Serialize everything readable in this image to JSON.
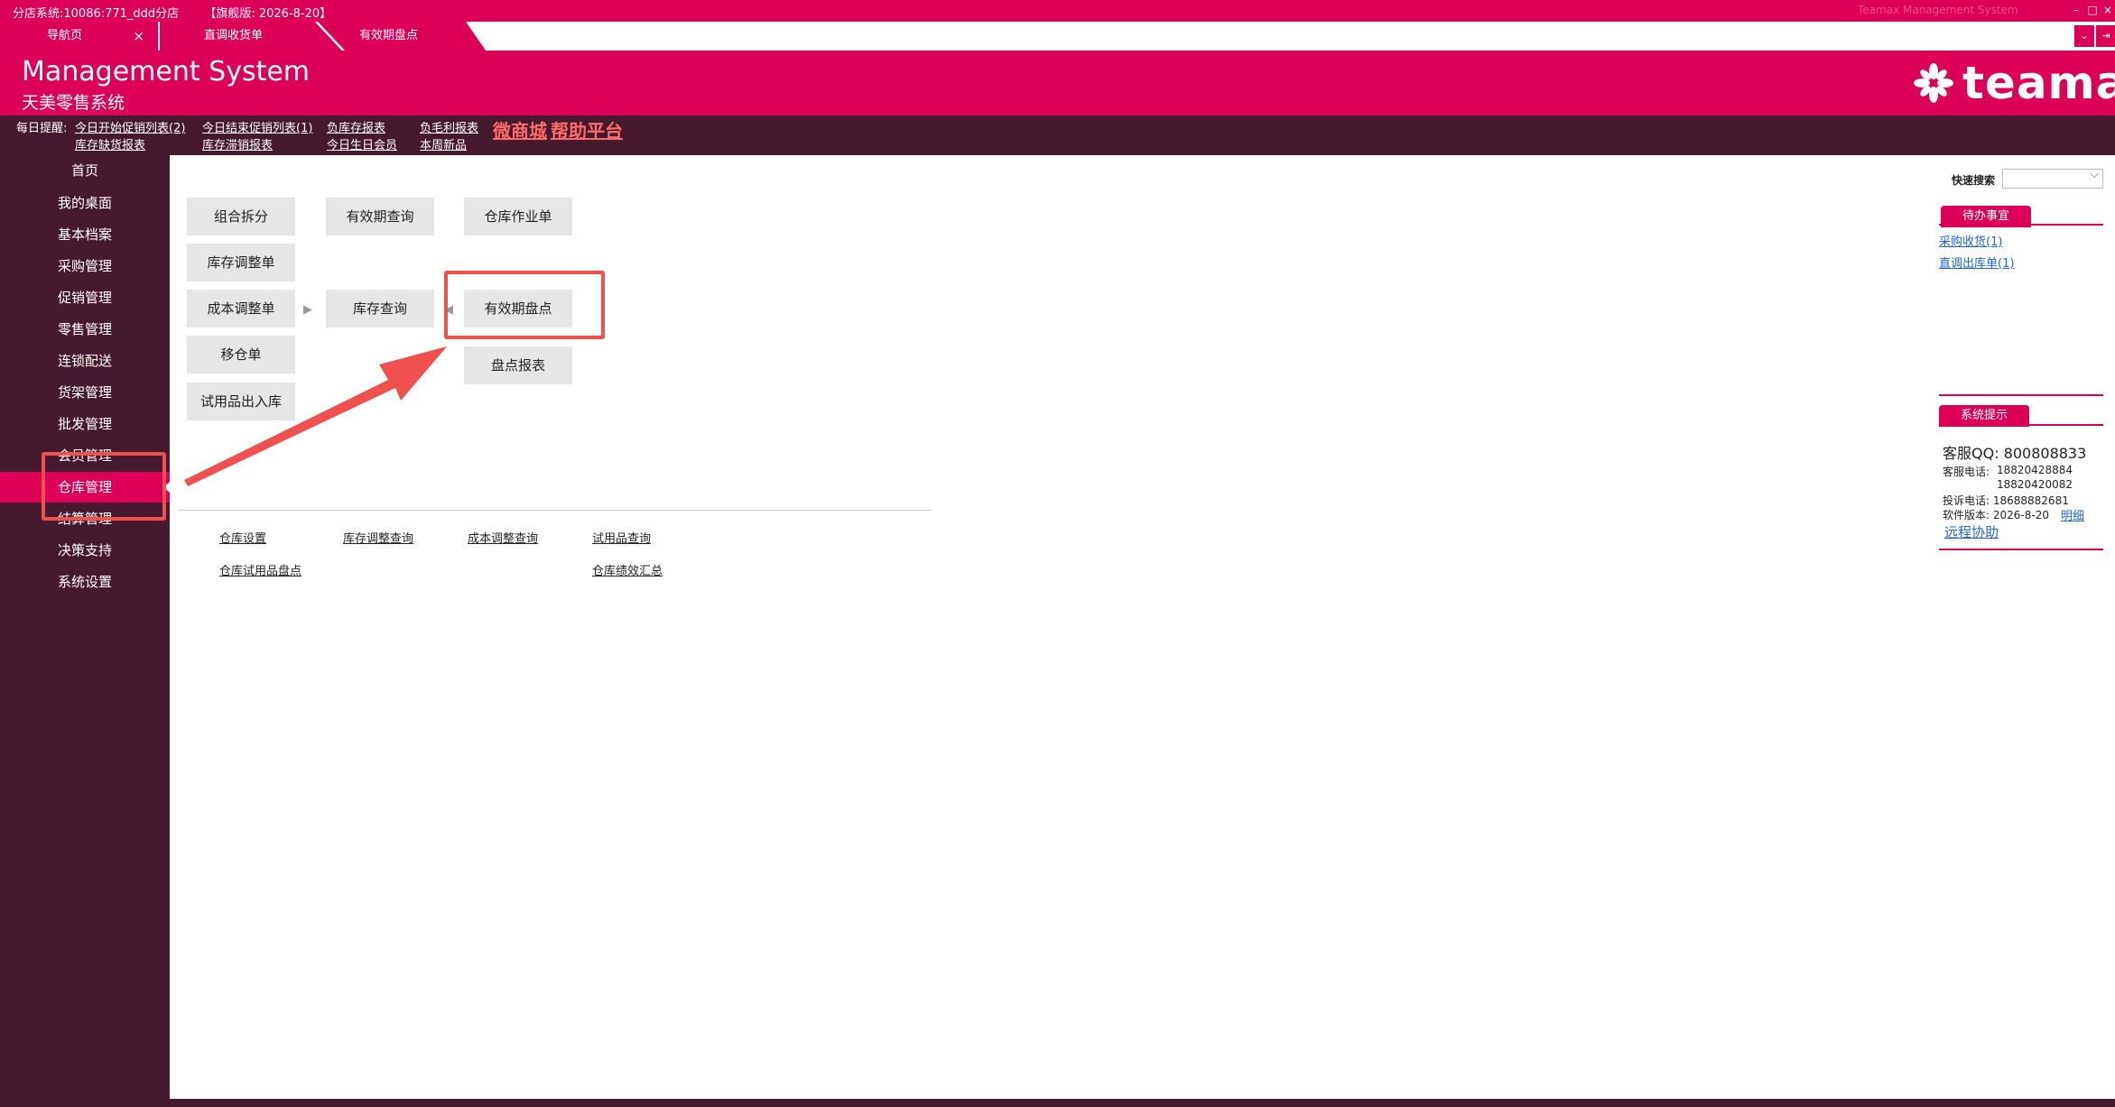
{
  "titlebar": {
    "system": "分店系统:10086:771_ddd分店",
    "edition": "【旗舰版: 2026-8-20】",
    "center": "Teamax Management System",
    "min": "–",
    "max": "□",
    "close": "×"
  },
  "tabs": [
    {
      "label": "导航页",
      "close": "×"
    },
    {
      "label": "直调收货单"
    },
    {
      "label": "有效期盘点"
    }
  ],
  "tab_right_buttons": [
    "⌄",
    "⇥"
  ],
  "header": {
    "title_en": "Management System",
    "title_cn": "天美零售系统",
    "logo_text": "teamax"
  },
  "notice": {
    "label": "每日提醒:",
    "links": [
      "今日开始促销列表(2)",
      "库存缺货报表",
      "今日结束促销列表(1)",
      "库存滞销报表",
      "负库存报表",
      "今日生日会员",
      "负毛利报表",
      "本周新品"
    ],
    "mall": "微商城",
    "help": "帮助平台"
  },
  "sidebar": {
    "items": [
      "首页",
      "我的桌面",
      "基本档案",
      "采购管理",
      "促销管理",
      "零售管理",
      "连锁配送",
      "货架管理",
      "批发管理",
      "会员管理",
      "仓库管理",
      "结算管理",
      "决策支持",
      "系统设置"
    ],
    "active_index": 10
  },
  "flow": {
    "buttons": [
      "组合拆分",
      "有效期查询",
      "仓库作业单",
      "库存调整单",
      "成本调整单",
      "库存查询",
      "有效期盘点",
      "移仓单",
      "盘点报表",
      "试用品出入库"
    ],
    "arrow_right": "▶",
    "arrow_left": "◀"
  },
  "quick_links": [
    "仓库设置",
    "库存调整查询",
    "成本调整查询",
    "试用品查询",
    "仓库试用品盘点",
    "仓库绩效汇总"
  ],
  "right_panel": {
    "quick_search_label": "快速搜索",
    "todo_title": "待办事宜",
    "todo_items": [
      "采购收货(1)",
      "直调出库单(1)"
    ],
    "tips_title": "系统提示",
    "qq": "客服QQ: 800808833",
    "phone_label": "客服电话:",
    "phone1": "18820428884",
    "phone2": "18820420082",
    "complaint": "投诉电话: 18688882681",
    "version": "软件版本: 2026-8-20",
    "version_link": "明细",
    "remote": "远程协助"
  },
  "colors": {
    "brand": "#dd0057",
    "sidebar": "#45192e",
    "annotation": "#f0504e"
  }
}
